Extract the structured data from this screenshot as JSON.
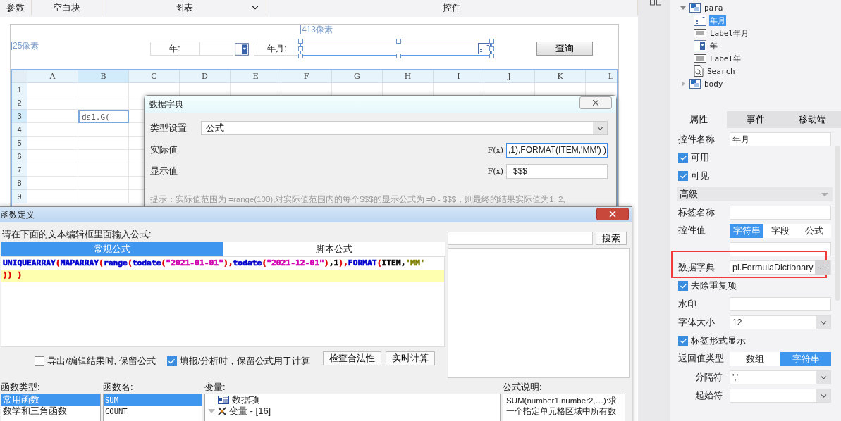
{
  "toolbar": {
    "groups": [
      {
        "label": "参数",
        "dropdown": false
      },
      {
        "label": "空白块",
        "dropdown": false
      },
      {
        "label": "图表",
        "dropdown": true
      },
      {
        "label": "控件",
        "dropdown": false
      }
    ]
  },
  "parameter_pane": {
    "width_note": "413像素",
    "height_note": "25像素",
    "widgets": [
      {
        "kind": "label",
        "text": "年:",
        "selected": false
      },
      {
        "kind": "combo",
        "selected": false
      },
      {
        "kind": "label",
        "text": "年月:",
        "selected": false
      },
      {
        "kind": "date",
        "selected": true
      },
      {
        "kind": "button",
        "text": "查询",
        "selected": false
      }
    ]
  },
  "sheet": {
    "columns": [
      {
        "label": "A",
        "selected": false
      },
      {
        "label": "B",
        "selected": true
      },
      {
        "label": "C",
        "selected": false
      },
      {
        "label": "D",
        "selected": false
      },
      {
        "label": "E",
        "selected": false
      },
      {
        "label": "F",
        "selected": false
      },
      {
        "label": "G",
        "selected": false
      },
      {
        "label": "H",
        "selected": false
      },
      {
        "label": "I",
        "selected": false
      },
      {
        "label": "J",
        "selected": false
      },
      {
        "label": "K",
        "selected": false
      },
      {
        "label": "L",
        "selected": false
      }
    ],
    "rows": [
      {
        "label": "1",
        "selected": false
      },
      {
        "label": "2",
        "selected": false
      },
      {
        "label": "3",
        "selected": true,
        "entry": "ds1.G("
      },
      {
        "label": "4",
        "selected": false
      },
      {
        "label": "5",
        "selected": false
      },
      {
        "label": "6",
        "selected": false
      },
      {
        "label": "7",
        "selected": false
      },
      {
        "label": "8",
        "selected": false
      },
      {
        "label": "9",
        "selected": false
      }
    ]
  },
  "dictionary_dialog": {
    "title": "数据字典",
    "type_label": "类型设置",
    "type_value": "公式",
    "fields": [
      {
        "label": "实际值",
        "mark": "F(x)",
        "value": ",1),FORMAT(ITEM,'MM') )",
        "focused": true
      },
      {
        "label": "显示值",
        "mark": "F(x)",
        "value": "=$$$",
        "focused": false
      }
    ],
    "hint": "提示：实际值范围为 =range(100),对实际值范围内的每个$$$的显示公式为 =0 - $$$，则最终的结果实际值为1, 2,"
  },
  "formula_dialog": {
    "title": "函数定义",
    "prompt": "请在下面的文本编辑框里面输入公式:",
    "search_button": "搜索",
    "tabs": [
      {
        "label": "常规公式",
        "selected": true
      },
      {
        "label": "脚本公式",
        "selected": false
      }
    ],
    "lines": [
      {
        "current": false,
        "tokens": [
          {
            "text": "UNIQUEARRAY",
            "color": "#0000cc"
          },
          {
            "text": "(",
            "color": "#e00000"
          },
          {
            "text": "MAPARRAY",
            "color": "#0000cc"
          },
          {
            "text": "(",
            "color": "#e00000"
          },
          {
            "text": "range",
            "color": "#0000cc"
          },
          {
            "text": "(",
            "color": "#e00000"
          },
          {
            "text": "todate",
            "color": "#0000cc"
          },
          {
            "text": "(",
            "color": "#e00000"
          },
          {
            "text": "\"2021-01-01\"",
            "color": "#d000b0"
          },
          {
            "text": "),",
            "color": "#e00000"
          },
          {
            "text": "todate",
            "color": "#0000cc"
          },
          {
            "text": "(",
            "color": "#e00000"
          },
          {
            "text": "\"2021-12-01\"",
            "color": "#d000b0"
          },
          {
            "text": ")",
            "color": "#e00000"
          },
          {
            "text": ",1",
            "color": "#000000"
          },
          {
            "text": "),",
            "color": "#e00000"
          },
          {
            "text": "FORMAT",
            "color": "#0000cc"
          },
          {
            "text": "(",
            "color": "#e00000"
          },
          {
            "text": "ITEM,",
            "color": "#000000"
          },
          {
            "text": "'MM'",
            "color": "#808000"
          }
        ]
      },
      {
        "current": true,
        "tokens": [
          {
            "text": ")) )",
            "color": "#e00000"
          }
        ]
      }
    ],
    "options": [
      {
        "label": "导出/编辑结果时, 保留公式",
        "checked": false
      },
      {
        "label": "填报/分析时，保留公式用于计算",
        "checked": true
      }
    ],
    "buttons": [
      "检查合法性",
      "实时计算"
    ],
    "function_types": {
      "title": "函数类型:",
      "items": [
        {
          "label": "常用函数",
          "selected": true
        },
        {
          "label": "数学和三角函数",
          "selected": false
        }
      ]
    },
    "function_names": {
      "title": "函数名:",
      "items": [
        {
          "label": "SUM",
          "selected": true
        },
        {
          "label": "COUNT",
          "selected": false
        }
      ]
    },
    "variables": {
      "title": "变量:",
      "items": [
        {
          "label": "数据项",
          "kind": "data",
          "expanded": false
        },
        {
          "label": "变量 - [16]",
          "kind": "var",
          "expanded": true
        }
      ]
    },
    "description": {
      "title": "公式说明:",
      "text": "SUM(number1,number2,…):求一个指定单元格区域中所有数"
    }
  },
  "widget_tree": [
    {
      "label": "para",
      "kind": "panel",
      "expanded": true,
      "selected": false,
      "children": [
        {
          "label": "年月",
          "kind": "date",
          "selected": true
        },
        {
          "label": "Label年月",
          "kind": "label",
          "selected": false
        },
        {
          "label": "年",
          "kind": "combo",
          "selected": false
        },
        {
          "label": "Label年",
          "kind": "label",
          "selected": false
        },
        {
          "label": "Search",
          "kind": "search",
          "selected": false
        }
      ]
    },
    {
      "label": "body",
      "kind": "panel",
      "expanded": false,
      "selected": false
    }
  ],
  "panel_tabs": [
    {
      "label": "属性",
      "selected": true
    },
    {
      "label": "事件",
      "selected": false
    },
    {
      "label": "移动端",
      "selected": false
    }
  ],
  "properties": [
    {
      "kind": "field",
      "label": "控件名称",
      "value": "年月"
    },
    {
      "kind": "check",
      "label": "可用",
      "checked": true
    },
    {
      "kind": "check",
      "label": "可见",
      "checked": true
    },
    {
      "kind": "section",
      "label": "高级",
      "expanded": true
    },
    {
      "kind": "field",
      "label": "标签名称"
    },
    {
      "kind": "segmented",
      "label": "控件值",
      "options": [
        {
          "label": "字符串",
          "selected": true
        },
        {
          "label": "字段",
          "selected": false
        },
        {
          "label": "公式",
          "selected": false
        }
      ],
      "children": [
        {
          "kind": "field"
        }
      ]
    },
    {
      "kind": "dictionary",
      "label": "数据字典",
      "value": "pl.FormulaDictionary",
      "button": "···",
      "highlighted": true
    },
    {
      "kind": "check",
      "label": "去除重复项",
      "checked": true
    },
    {
      "kind": "field",
      "label": "水印"
    },
    {
      "kind": "select",
      "label": "字体大小",
      "value": "12"
    },
    {
      "kind": "check",
      "label": "标签形式显示",
      "checked": true
    },
    {
      "kind": "segmented",
      "label": "返回值类型",
      "options": [
        {
          "label": "数组",
          "selected": false
        },
        {
          "label": "字符串",
          "selected": true
        }
      ],
      "children": [
        {
          "kind": "select",
          "label": "分隔符",
          "value": "','"
        },
        {
          "kind": "select",
          "label": "起始符"
        }
      ]
    }
  ]
}
